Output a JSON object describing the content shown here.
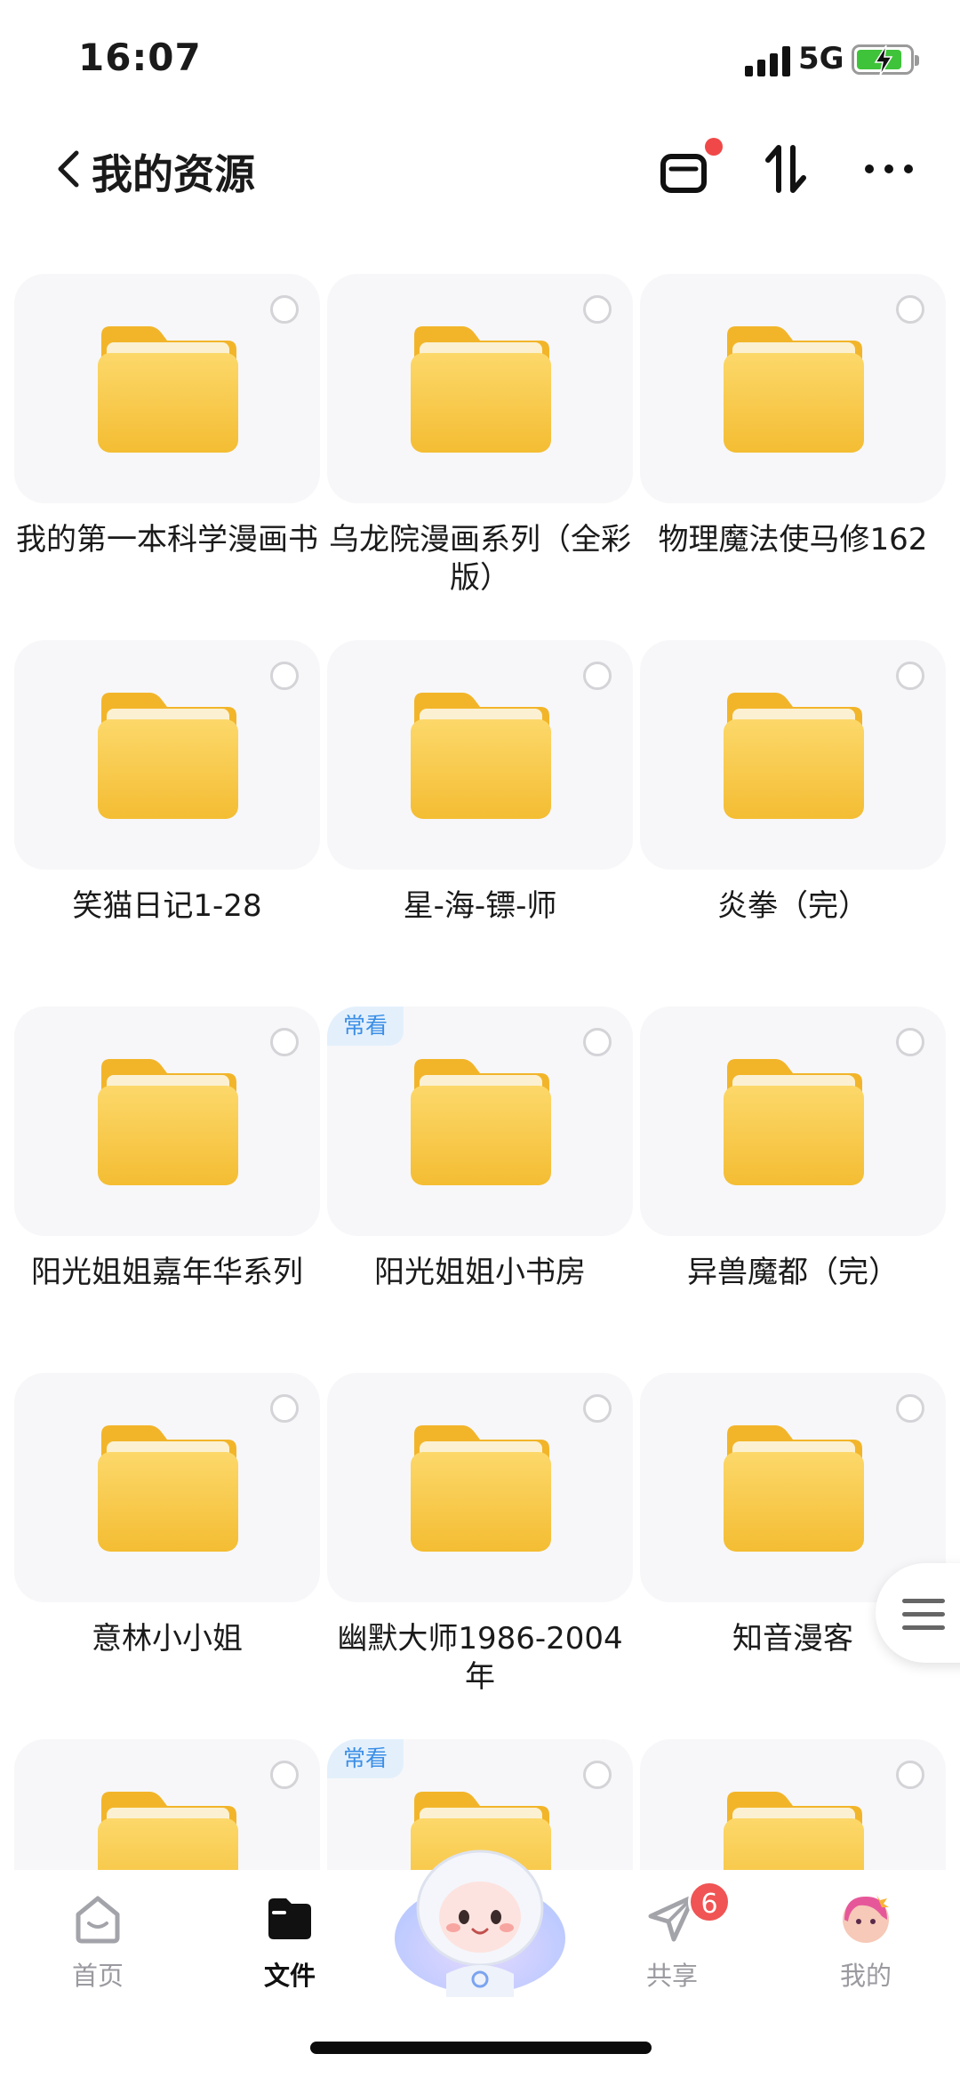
{
  "status_bar": {
    "time": "16:07",
    "network": "5G"
  },
  "header": {
    "title": "我的资源"
  },
  "folders": [
    {
      "label": "我的第一本科学漫画书",
      "badge": ""
    },
    {
      "label": "乌龙院漫画系列（全彩版）",
      "badge": ""
    },
    {
      "label": "物理魔法使马修162",
      "badge": ""
    },
    {
      "label": "笑猫日记1-28",
      "badge": ""
    },
    {
      "label": "星-海-镖-师",
      "badge": ""
    },
    {
      "label": "炎拳（完）",
      "badge": ""
    },
    {
      "label": "阳光姐姐嘉年华系列",
      "badge": ""
    },
    {
      "label": "阳光姐姐小书房",
      "badge": "常看"
    },
    {
      "label": "异兽魔都（完）",
      "badge": ""
    },
    {
      "label": "意林小小姐",
      "badge": ""
    },
    {
      "label": "幽默大师1986-2004年",
      "badge": ""
    },
    {
      "label": "知音漫客",
      "badge": ""
    },
    {
      "label": "",
      "badge": ""
    },
    {
      "label": "",
      "badge": "常看"
    },
    {
      "label": "",
      "badge": ""
    }
  ],
  "bottom_nav": {
    "items": [
      {
        "label": "首页",
        "icon": "home-icon"
      },
      {
        "label": "文件",
        "icon": "folder-icon",
        "active": true
      },
      {
        "label": "共享",
        "icon": "paper-plane-icon",
        "badge": "6"
      },
      {
        "label": "我的",
        "icon": "avatar-icon"
      }
    ]
  },
  "colors": {
    "folder": "#f7c43a",
    "badge_text": "#3b8ee6",
    "notification": "#f05454"
  }
}
